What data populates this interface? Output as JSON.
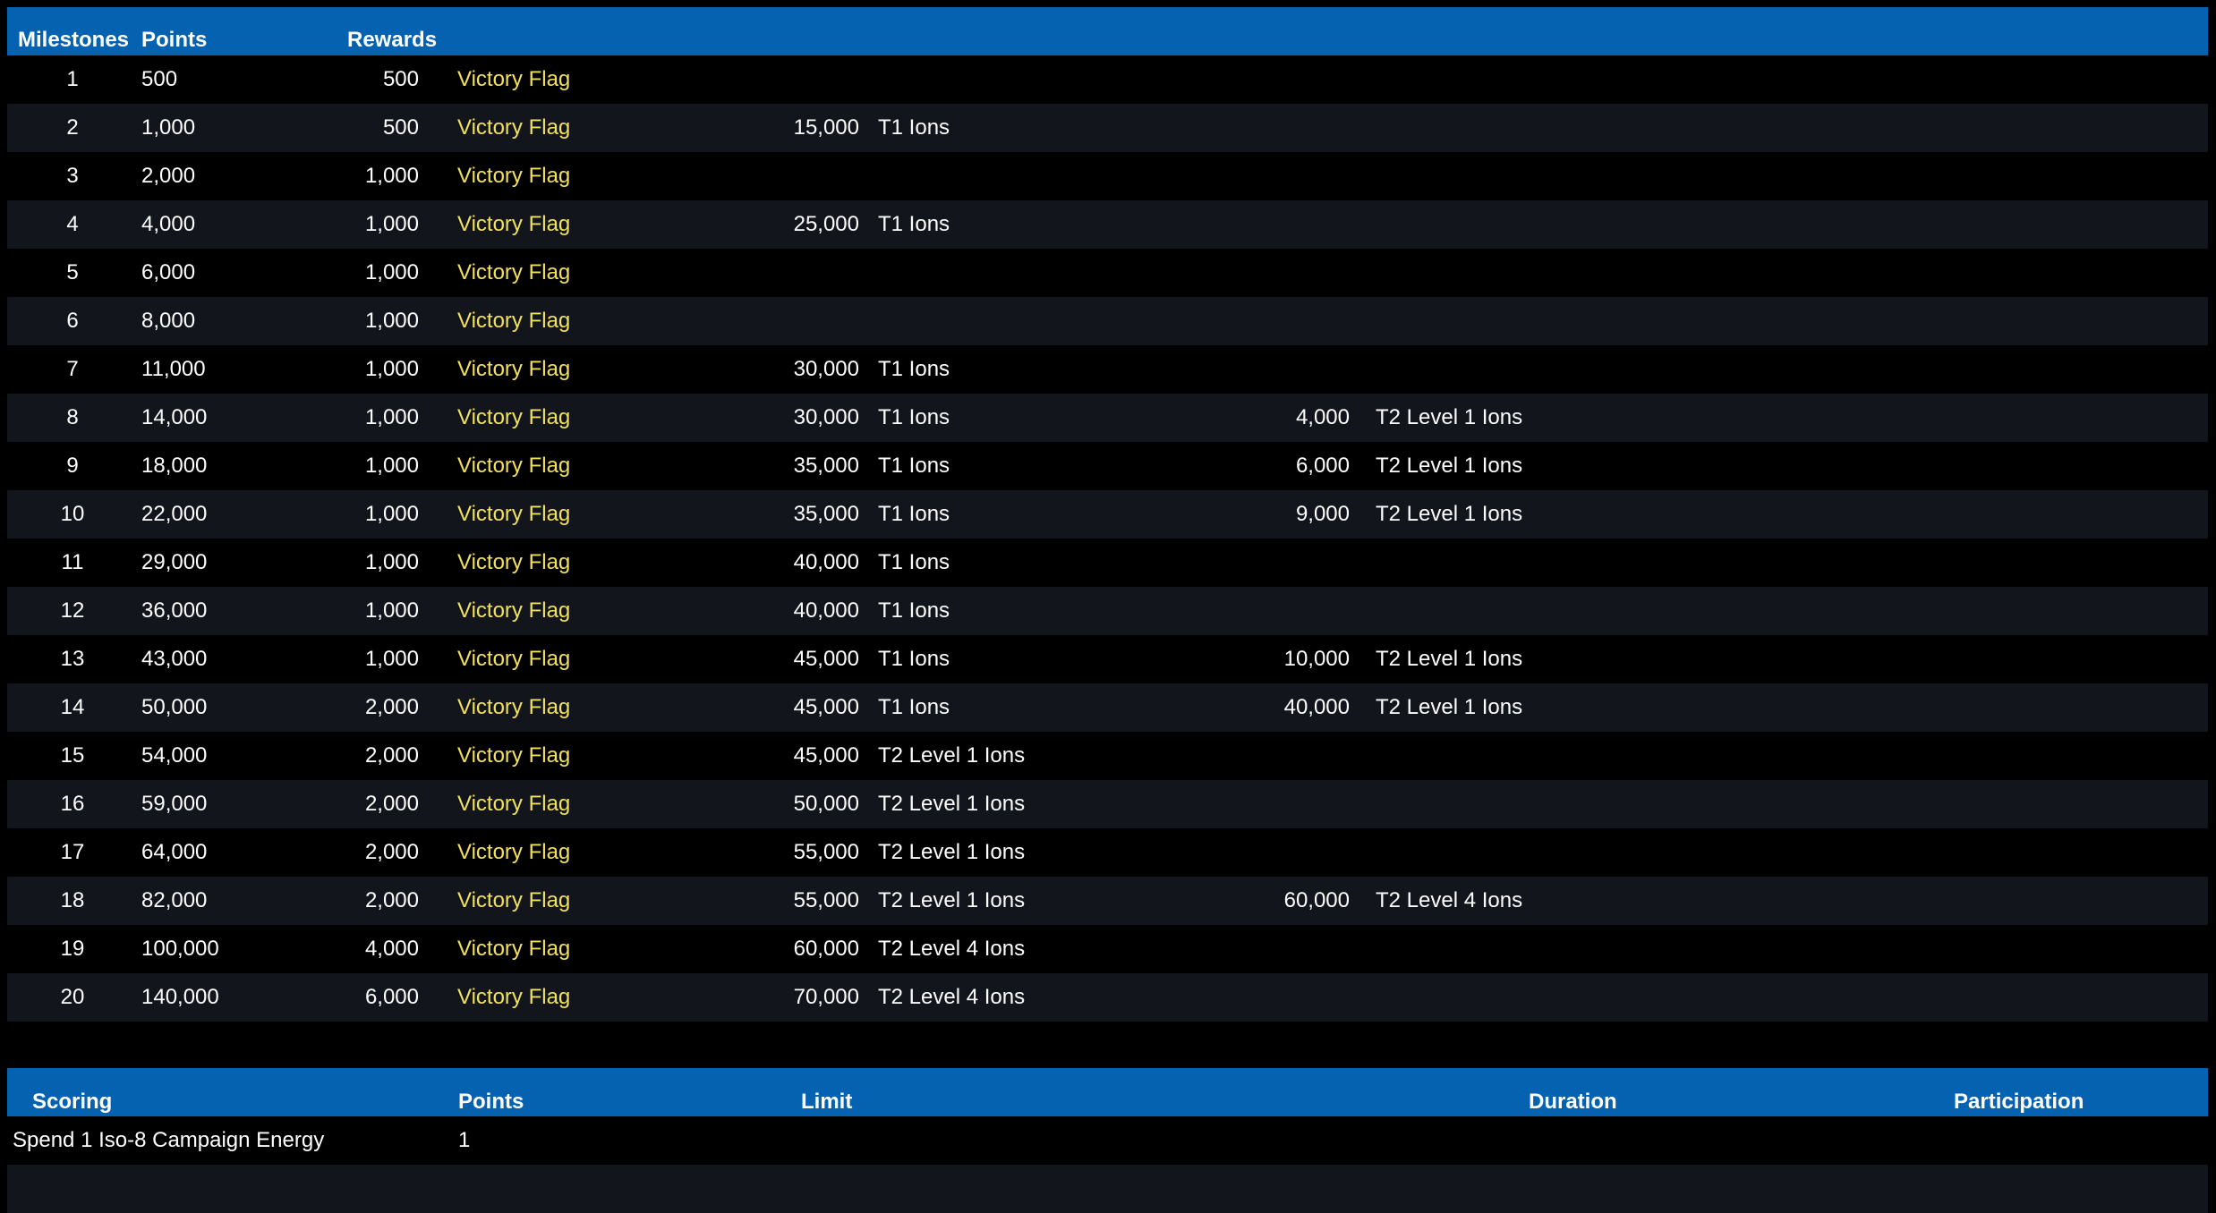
{
  "milestones": {
    "headers": {
      "milestones": "Milestones",
      "points": "Points",
      "rewards": "Rewards"
    },
    "rows": [
      {
        "num": "1",
        "points": "500",
        "reward": "500",
        "flag": "Victory Flag",
        "amt2": "",
        "item2": "",
        "amt3": "",
        "item3": ""
      },
      {
        "num": "2",
        "points": "1,000",
        "reward": "500",
        "flag": "Victory Flag",
        "amt2": "15,000",
        "item2": "T1 Ions",
        "amt3": "",
        "item3": ""
      },
      {
        "num": "3",
        "points": "2,000",
        "reward": "1,000",
        "flag": "Victory Flag",
        "amt2": "",
        "item2": "",
        "amt3": "",
        "item3": ""
      },
      {
        "num": "4",
        "points": "4,000",
        "reward": "1,000",
        "flag": "Victory Flag",
        "amt2": "25,000",
        "item2": "T1 Ions",
        "amt3": "",
        "item3": ""
      },
      {
        "num": "5",
        "points": "6,000",
        "reward": "1,000",
        "flag": "Victory Flag",
        "amt2": "",
        "item2": "",
        "amt3": "",
        "item3": ""
      },
      {
        "num": "6",
        "points": "8,000",
        "reward": "1,000",
        "flag": "Victory Flag",
        "amt2": "",
        "item2": "",
        "amt3": "",
        "item3": ""
      },
      {
        "num": "7",
        "points": "11,000",
        "reward": "1,000",
        "flag": "Victory Flag",
        "amt2": "30,000",
        "item2": "T1 Ions",
        "amt3": "",
        "item3": ""
      },
      {
        "num": "8",
        "points": "14,000",
        "reward": "1,000",
        "flag": "Victory Flag",
        "amt2": "30,000",
        "item2": "T1 Ions",
        "amt3": "4,000",
        "item3": "T2 Level 1 Ions"
      },
      {
        "num": "9",
        "points": "18,000",
        "reward": "1,000",
        "flag": "Victory Flag",
        "amt2": "35,000",
        "item2": "T1 Ions",
        "amt3": "6,000",
        "item3": "T2 Level 1 Ions"
      },
      {
        "num": "10",
        "points": "22,000",
        "reward": "1,000",
        "flag": "Victory Flag",
        "amt2": "35,000",
        "item2": "T1 Ions",
        "amt3": "9,000",
        "item3": "T2 Level 1 Ions"
      },
      {
        "num": "11",
        "points": "29,000",
        "reward": "1,000",
        "flag": "Victory Flag",
        "amt2": "40,000",
        "item2": "T1 Ions",
        "amt3": "",
        "item3": ""
      },
      {
        "num": "12",
        "points": "36,000",
        "reward": "1,000",
        "flag": "Victory Flag",
        "amt2": "40,000",
        "item2": "T1 Ions",
        "amt3": "",
        "item3": ""
      },
      {
        "num": "13",
        "points": "43,000",
        "reward": "1,000",
        "flag": "Victory Flag",
        "amt2": "45,000",
        "item2": "T1 Ions",
        "amt3": "10,000",
        "item3": "T2 Level 1 Ions"
      },
      {
        "num": "14",
        "points": "50,000",
        "reward": "2,000",
        "flag": "Victory Flag",
        "amt2": "45,000",
        "item2": "T1 Ions",
        "amt3": "40,000",
        "item3": "T2 Level 1 Ions"
      },
      {
        "num": "15",
        "points": "54,000",
        "reward": "2,000",
        "flag": "Victory Flag",
        "amt2": "45,000",
        "item2": "T2 Level 1 Ions",
        "amt3": "",
        "item3": ""
      },
      {
        "num": "16",
        "points": "59,000",
        "reward": "2,000",
        "flag": "Victory Flag",
        "amt2": "50,000",
        "item2": "T2 Level 1 Ions",
        "amt3": "",
        "item3": ""
      },
      {
        "num": "17",
        "points": "64,000",
        "reward": "2,000",
        "flag": "Victory Flag",
        "amt2": "55,000",
        "item2": "T2 Level 1 Ions",
        "amt3": "",
        "item3": ""
      },
      {
        "num": "18",
        "points": "82,000",
        "reward": "2,000",
        "flag": "Victory Flag",
        "amt2": "55,000",
        "item2": "T2 Level 1 Ions",
        "amt3": "60,000",
        "item3": "T2 Level 4 Ions"
      },
      {
        "num": "19",
        "points": "100,000",
        "reward": "4,000",
        "flag": "Victory Flag",
        "amt2": "60,000",
        "item2": "T2 Level 4 Ions",
        "amt3": "",
        "item3": ""
      },
      {
        "num": "20",
        "points": "140,000",
        "reward": "6,000",
        "flag": "Victory Flag",
        "amt2": "70,000",
        "item2": "T2 Level 4 Ions",
        "amt3": "",
        "item3": ""
      }
    ]
  },
  "scoring": {
    "headers": {
      "scoring": "Scoring",
      "points": "Points",
      "limit": "Limit",
      "duration": "Duration",
      "participation": "Participation"
    },
    "rows": [
      {
        "label": "Spend 1 Iso-8 Campaign Energy",
        "points": "1"
      },
      {
        "label": "",
        "points": ""
      }
    ]
  },
  "colors": {
    "header_bg": "#0562b1",
    "alt_row_bg": "#12151b",
    "flag_text": "#f2e15c",
    "page_bg": "#000000"
  }
}
